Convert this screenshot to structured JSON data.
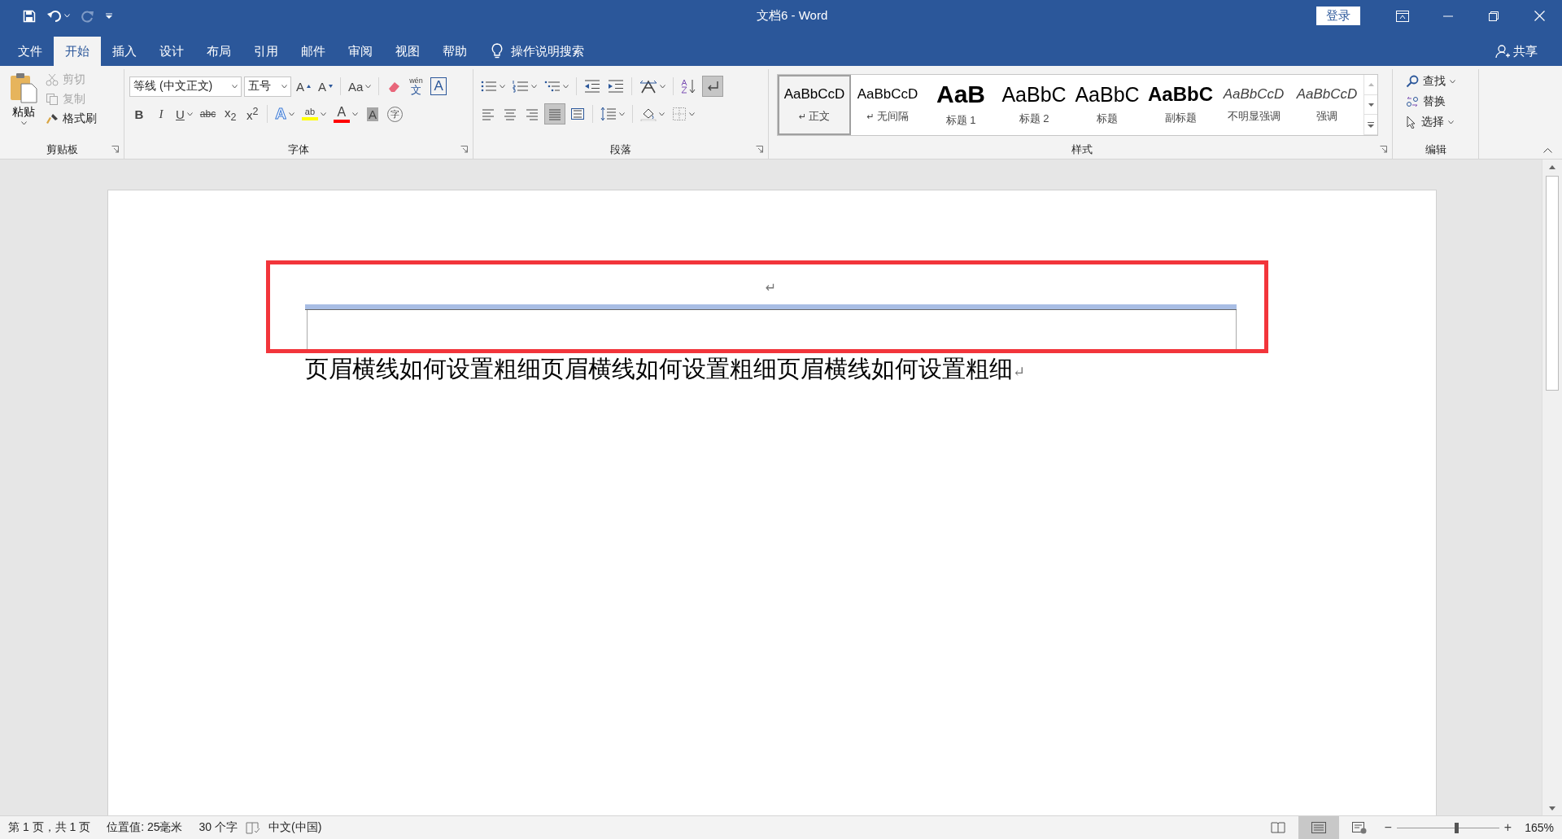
{
  "window": {
    "title": "文档6 - Word",
    "sign_in": "登录",
    "share": "共享"
  },
  "tabs": [
    {
      "label": "文件",
      "selected": false
    },
    {
      "label": "开始",
      "selected": true
    },
    {
      "label": "插入",
      "selected": false
    },
    {
      "label": "设计",
      "selected": false
    },
    {
      "label": "布局",
      "selected": false
    },
    {
      "label": "引用",
      "selected": false
    },
    {
      "label": "邮件",
      "selected": false
    },
    {
      "label": "审阅",
      "selected": false
    },
    {
      "label": "视图",
      "selected": false
    },
    {
      "label": "帮助",
      "selected": false
    }
  ],
  "tell_me": {
    "placeholder": "操作说明搜索"
  },
  "ribbon": {
    "clipboard": {
      "label": "剪贴板",
      "paste": "粘贴",
      "items": [
        {
          "kind": "cut",
          "label": "剪切",
          "disabled": true
        },
        {
          "kind": "copy",
          "label": "复制",
          "disabled": true
        },
        {
          "kind": "painter",
          "label": "格式刷",
          "disabled": false
        }
      ]
    },
    "font": {
      "label": "字体",
      "font_name": "等线 (中文正文)",
      "font_size": "五号",
      "row_1": [
        {
          "kind": "grow",
          "label": "A"
        },
        {
          "kind": "shrink",
          "label": "A"
        },
        {
          "kind": "case",
          "label": "Aa"
        },
        {
          "kind": "clear"
        },
        {
          "kind": "phonetic",
          "label": "文",
          "ruby": "wén"
        },
        {
          "kind": "boxed",
          "label": "A"
        }
      ],
      "row_2": [
        {
          "kind": "bold",
          "label": "B"
        },
        {
          "kind": "italic",
          "label": "I"
        },
        {
          "kind": "underline",
          "label": "U"
        },
        {
          "kind": "strike",
          "label": "abc"
        },
        {
          "kind": "sub",
          "label": "x$_{2}$"
        },
        {
          "kind": "sup",
          "label": "x$^{2}$"
        },
        {
          "kind": "effect",
          "label": "A"
        },
        {
          "kind": "highlight",
          "label": "ab",
          "color": "#ffff00"
        },
        {
          "kind": "color",
          "label": "A",
          "color": "#ff0000"
        },
        {
          "kind": "shading",
          "label": "A"
        },
        {
          "kind": "enclose",
          "label": "字"
        }
      ]
    },
    "paragraph": {
      "label": "段落",
      "show_marks": true,
      "align": [
        {
          "kind": "left",
          "selected": false
        },
        {
          "kind": "center",
          "selected": false
        },
        {
          "kind": "right",
          "selected": false
        },
        {
          "kind": "justify",
          "selected": true
        },
        {
          "kind": "distributed",
          "selected": false
        }
      ]
    },
    "styles": {
      "label": "样式",
      "items": [
        {
          "kind": "normal",
          "preview": "AaBbCcD",
          "mark": "↵",
          "label": "正文",
          "selected": true
        },
        {
          "kind": "normal",
          "preview": "AaBbCcD",
          "mark": "↵",
          "label": "无间隔",
          "selected": false
        },
        {
          "kind": "heading1",
          "preview": "AaB",
          "label": "标题 1",
          "selected": false
        },
        {
          "kind": "heading2",
          "preview": "AaBbC",
          "label": "标题 2",
          "selected": false
        },
        {
          "kind": "title",
          "preview": "AaBbC",
          "label": "标题",
          "selected": false
        },
        {
          "kind": "subtitle",
          "preview": "AaBbC",
          "label": "副标题",
          "selected": false
        },
        {
          "kind": "subtle",
          "preview": "AaBbCcD",
          "label": "不明显强调",
          "selected": false
        },
        {
          "kind": "emphasis",
          "preview": "AaBbCcD",
          "label": "强调",
          "selected": false
        }
      ]
    },
    "editing": {
      "label": "编辑",
      "items": [
        {
          "kind": "find",
          "label": "查找"
        },
        {
          "kind": "replace",
          "label": "替换"
        },
        {
          "kind": "select",
          "label": "选择"
        }
      ]
    }
  },
  "document": {
    "header_mark": "↵",
    "body": "页眉横线如何设置粗细页眉横线如何设置粗细页眉横线如何设置粗细",
    "body_mark": "↵"
  },
  "status_bar": {
    "page": "第 1 页，共 1 页",
    "position": "位置值: 25毫米",
    "words": "30 个字",
    "language": "中文(中国)",
    "views": [
      {
        "kind": "read",
        "selected": false
      },
      {
        "kind": "print",
        "selected": true
      },
      {
        "kind": "web",
        "selected": false
      }
    ],
    "zoom": {
      "out": "−",
      "level": 0.58,
      "in": "+",
      "reading": "165%"
    }
  }
}
